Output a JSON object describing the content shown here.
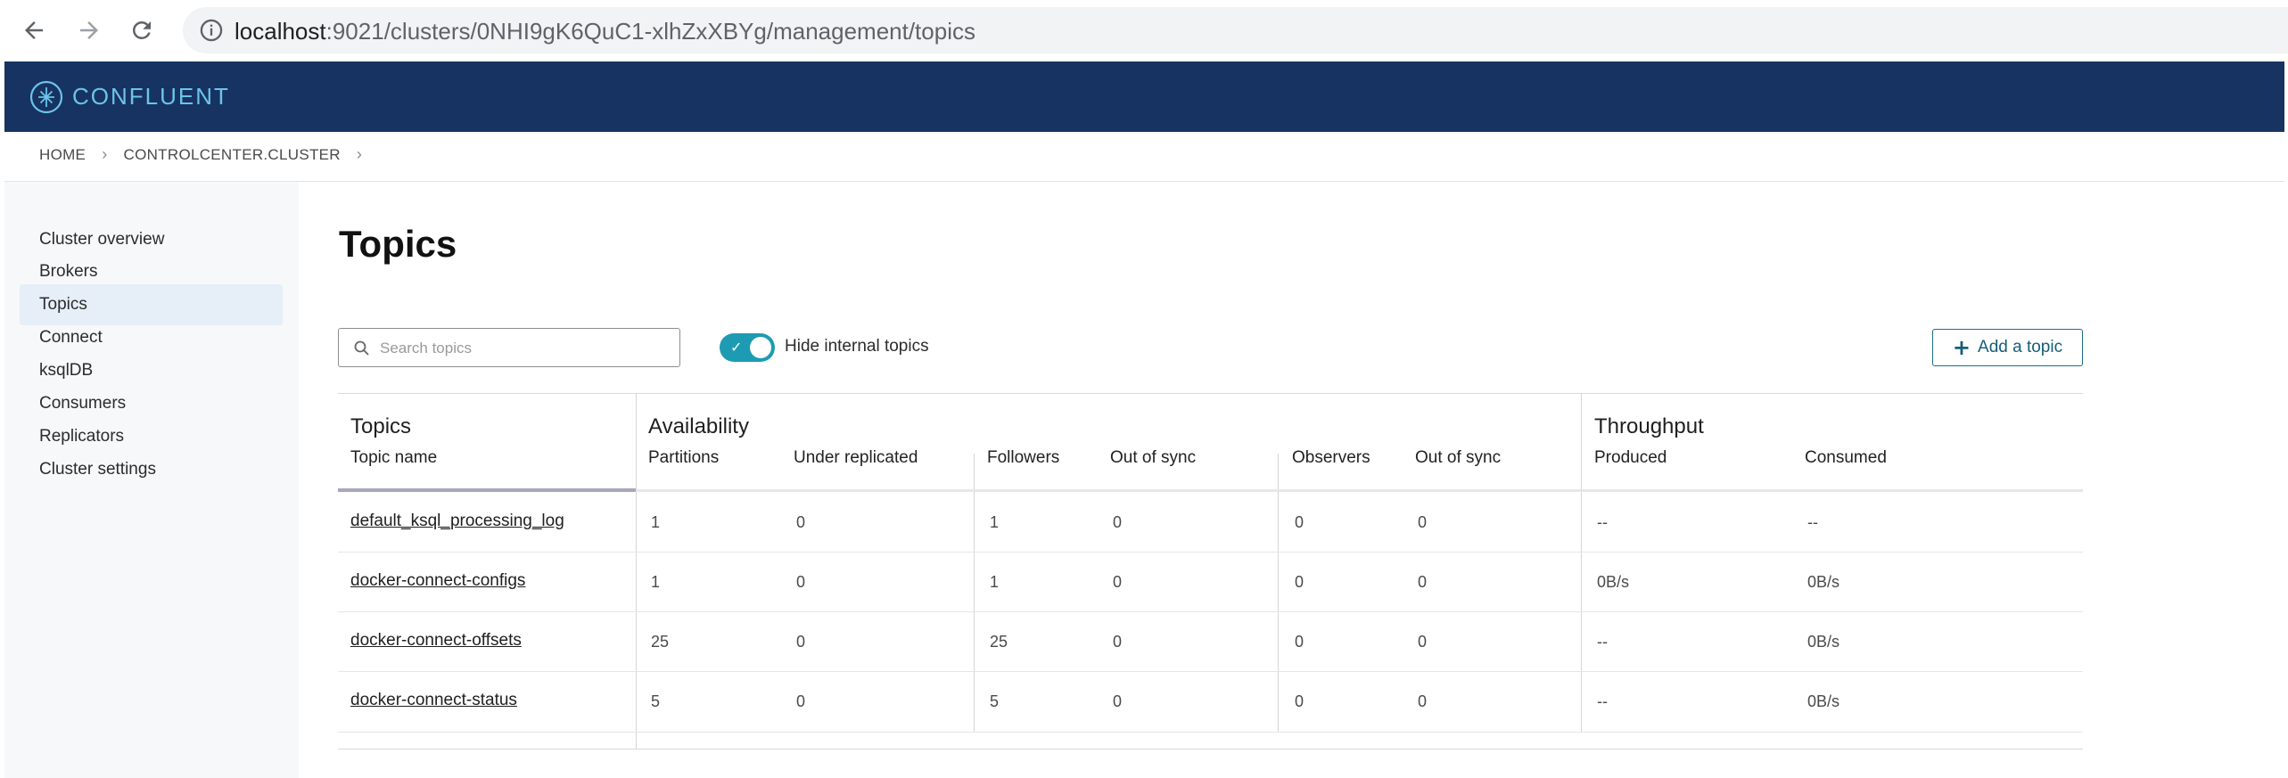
{
  "browser": {
    "url_host": "localhost",
    "url_path": ":9021/clusters/0NHI9gK6QuC1-xlhZxXBYg/management/topics"
  },
  "header": {
    "brand": "CONFLUENT"
  },
  "breadcrumb": [
    "HOME",
    "CONTROLCENTER.CLUSTER"
  ],
  "sidebar": {
    "items": [
      {
        "label": "Cluster overview"
      },
      {
        "label": "Brokers"
      },
      {
        "label": "Topics"
      },
      {
        "label": "Connect"
      },
      {
        "label": "ksqlDB"
      },
      {
        "label": "Consumers"
      },
      {
        "label": "Replicators"
      },
      {
        "label": "Cluster settings"
      }
    ],
    "active": "Topics"
  },
  "main": {
    "title": "Topics",
    "search": {
      "placeholder": "Search topics",
      "value": ""
    },
    "toggle": {
      "label": "Hide internal topics",
      "on": true
    },
    "add_button": "Add a topic"
  },
  "table": {
    "groups": {
      "topics": "Topics",
      "availability": "Availability",
      "throughput": "Throughput"
    },
    "columns": {
      "topic_name": "Topic name",
      "partitions": "Partitions",
      "under_replicated": "Under replicated",
      "followers": "Followers",
      "out_of_sync_1": "Out of sync",
      "observers": "Observers",
      "out_of_sync_2": "Out of sync",
      "produced": "Produced",
      "consumed": "Consumed"
    },
    "rows": [
      {
        "name": "default_ksql_processing_log",
        "partitions": "1",
        "under_replicated": "0",
        "followers": "1",
        "out_of_sync_1": "0",
        "observers": "0",
        "out_of_sync_2": "0",
        "produced": "--",
        "consumed": "--"
      },
      {
        "name": "docker-connect-configs",
        "partitions": "1",
        "under_replicated": "0",
        "followers": "1",
        "out_of_sync_1": "0",
        "observers": "0",
        "out_of_sync_2": "0",
        "produced": "0B/s",
        "consumed": "0B/s"
      },
      {
        "name": "docker-connect-offsets",
        "partitions": "25",
        "under_replicated": "0",
        "followers": "25",
        "out_of_sync_1": "0",
        "observers": "0",
        "out_of_sync_2": "0",
        "produced": "--",
        "consumed": "0B/s"
      },
      {
        "name": "docker-connect-status",
        "partitions": "5",
        "under_replicated": "0",
        "followers": "5",
        "out_of_sync_1": "0",
        "observers": "0",
        "out_of_sync_2": "0",
        "produced": "--",
        "consumed": "0B/s"
      }
    ]
  },
  "colors": {
    "header_bg": "#173361",
    "brand_text": "#6cc3ea",
    "toggle_on": "#1d9bb3",
    "button_border": "#1b6e8a",
    "sidebar_active": "#e6eef8"
  }
}
